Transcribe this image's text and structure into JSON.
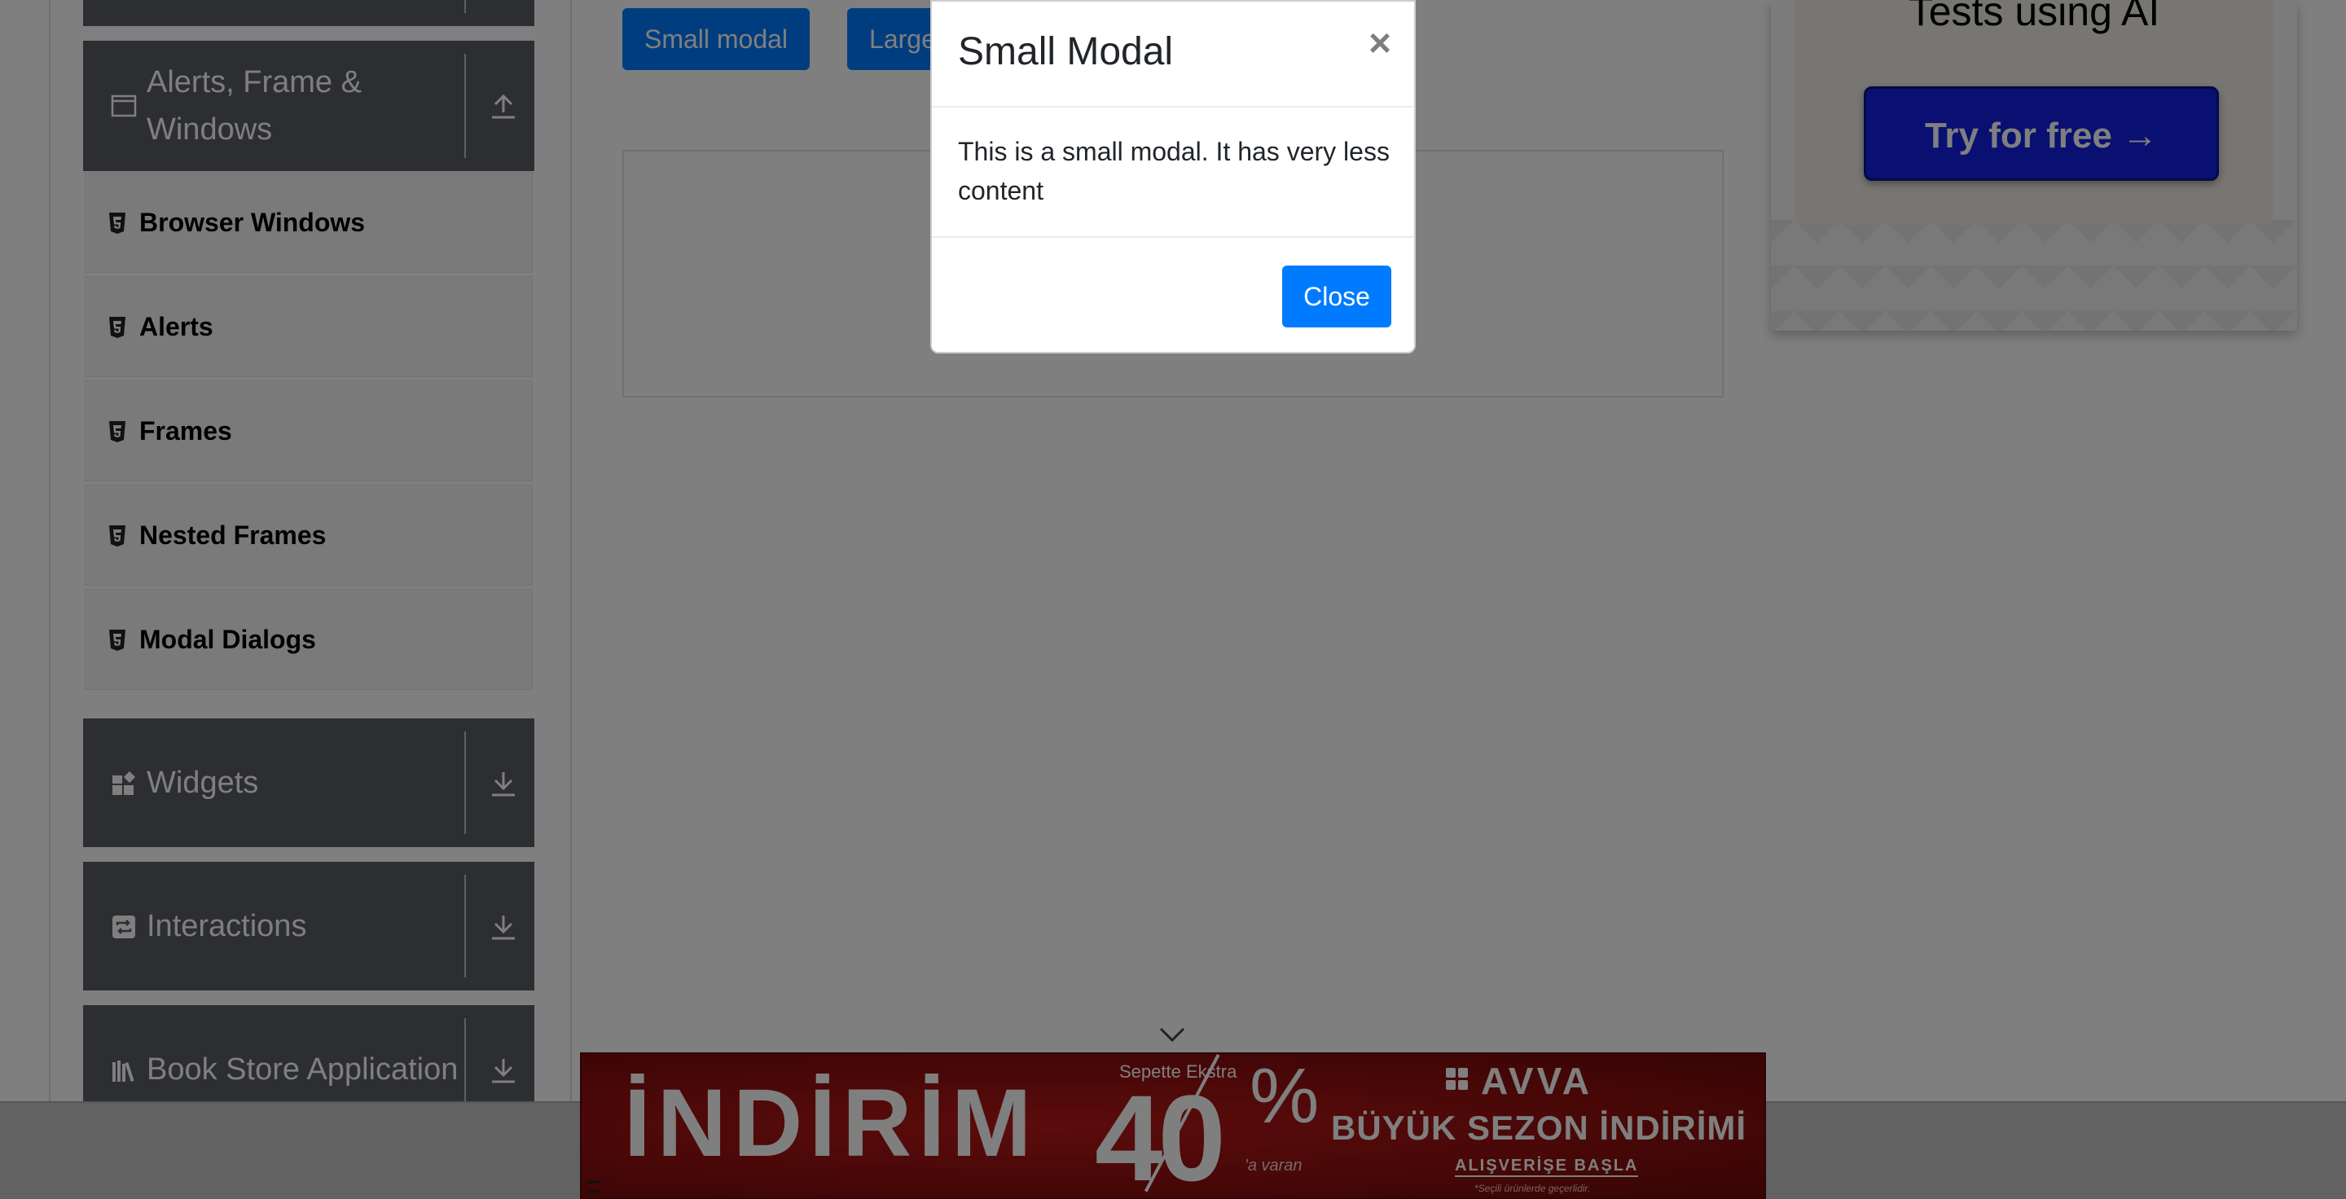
{
  "sidebar": {
    "groups": [
      {
        "name": "alerts-frame-windows",
        "title": "Alerts, Frame & Windows",
        "icon": "window-icon",
        "toggle": "collapse-up-icon"
      },
      {
        "name": "widgets",
        "title": "Widgets",
        "icon": "widgets-icon",
        "toggle": "expand-down-icon"
      },
      {
        "name": "interactions",
        "title": "Interactions",
        "icon": "interactions-icon",
        "toggle": "expand-down-icon"
      },
      {
        "name": "book-store",
        "title": "Book Store Application",
        "icon": "books-icon",
        "toggle": "expand-down-icon"
      }
    ],
    "items": [
      {
        "label": "Browser Windows",
        "icon": "html5-icon"
      },
      {
        "label": "Alerts",
        "icon": "html5-icon"
      },
      {
        "label": "Frames",
        "icon": "html5-icon"
      },
      {
        "label": "Nested Frames",
        "icon": "html5-icon"
      },
      {
        "label": "Modal Dialogs",
        "icon": "html5-icon"
      }
    ]
  },
  "main": {
    "small_modal_label": "Small modal",
    "large_modal_label": "Large modal"
  },
  "ad": {
    "heading": "Tests using AI",
    "cta": "Try for free →"
  },
  "modal": {
    "title": "Small Modal",
    "close_symbol": "×",
    "body": "This is a small modal. It has very less content",
    "close_button": "Close"
  },
  "banner": {
    "main_text": "İNDİRİM",
    "ekstra": "Sepette Ekstra",
    "number": "40",
    "percent": "%",
    "varan": "'a varan",
    "brand": "AVVA",
    "sezon": "BÜYÜK SEZON İNDİRİMİ",
    "cta": "ALIŞVERİŞE BAŞLA",
    "small_print": "*Seçili ürünlerde geçerlidir."
  },
  "colors": {
    "sidebar_group": "#585c63",
    "primary": "#007bff",
    "ad_cta": "#1221e3",
    "banner_red": "#a01414"
  }
}
